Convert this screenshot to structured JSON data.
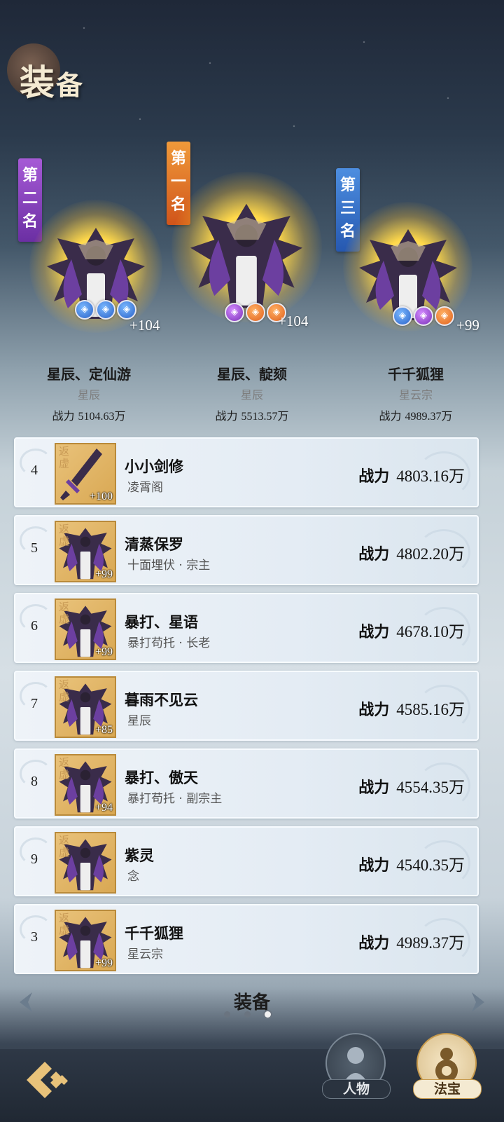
{
  "page": {
    "title_big": "装",
    "title_small": "备"
  },
  "podium": [
    {
      "place_label": "第二名",
      "name": "星辰、定仙游",
      "sect": "星辰",
      "power_label": "战力",
      "power": "5104.63万",
      "plus": "+104",
      "orbs": [
        "blue",
        "blue",
        "blue"
      ]
    },
    {
      "place_label": "第一名",
      "name": "星辰、靛颏",
      "sect": "星辰",
      "power_label": "战力",
      "power": "5513.57万",
      "plus": "+104",
      "orbs": [
        "purple",
        "orange",
        "orange"
      ]
    },
    {
      "place_label": "第三名",
      "name": "千千狐狸",
      "sect": "星云宗",
      "power_label": "战力",
      "power": "4989.37万",
      "plus": "+99",
      "orbs": [
        "blue",
        "purple",
        "orange"
      ]
    }
  ],
  "banners": {
    "second": [
      "第",
      "二",
      "名"
    ],
    "first": [
      "第",
      "一",
      "名"
    ],
    "third": [
      "第",
      "三",
      "名"
    ]
  },
  "avatar_badge": "返虚",
  "rows": [
    {
      "rank": "4",
      "name": "小小剑修",
      "sect": "凌霄阁",
      "power_label": "战力",
      "power": "4803.16万",
      "level": "+100"
    },
    {
      "rank": "5",
      "name": "清蒸保罗",
      "sect": "十面埋伏 · 宗主",
      "power_label": "战力",
      "power": "4802.20万",
      "level": "+99"
    },
    {
      "rank": "6",
      "name": "暴打、星语",
      "sect": "暴打苟托 · 长老",
      "power_label": "战力",
      "power": "4678.10万",
      "level": "+99"
    },
    {
      "rank": "7",
      "name": "暮雨不见云",
      "sect": "星辰",
      "power_label": "战力",
      "power": "4585.16万",
      "level": "+85"
    },
    {
      "rank": "8",
      "name": "暴打、傲天",
      "sect": "暴打苟托 · 副宗主",
      "power_label": "战力",
      "power": "4554.35万",
      "level": "+94"
    },
    {
      "rank": "9",
      "name": "紫灵",
      "sect": "念",
      "power_label": "战力",
      "power": "4540.35万",
      "level": ""
    }
  ],
  "my_row": {
    "rank": "3",
    "name": "千千狐狸",
    "sect": "星云宗",
    "power_label": "战力",
    "power": "4989.37万",
    "level": "+99"
  },
  "footer": {
    "category_title": "装备",
    "pages": 3,
    "active_page": 3,
    "tab_person": "人物",
    "tab_treasure": "法宝"
  },
  "colors": {
    "accent_gold": "#e8c27a",
    "card_bg": "#e4ecf4",
    "bar_bg": "#242d39"
  }
}
